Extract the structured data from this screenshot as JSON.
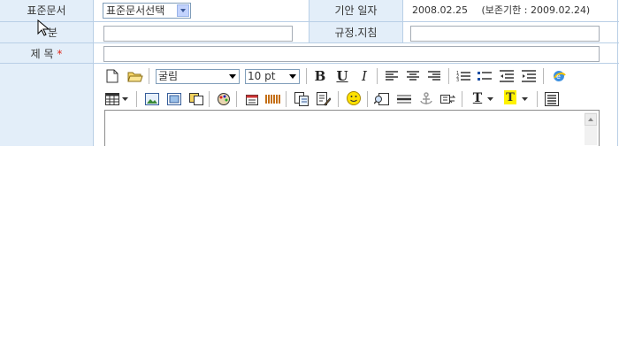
{
  "rows": {
    "standard_doc": {
      "label": "표준문서",
      "select_value": "표준문서선택"
    },
    "draft_date": {
      "label": "기안 일자",
      "value": "2008.02.25",
      "retention": "(보존기한 : 2009.02.24)"
    },
    "category": {
      "label": "분"
    },
    "regulation": {
      "label": "규정.지침"
    },
    "title": {
      "label": "제 목",
      "required_mark": "*"
    }
  },
  "toolbar": {
    "font_name": "굴림",
    "font_size": "10 pt",
    "bold": "B",
    "underline": "U",
    "italic": "I",
    "text_color_glyph": "T",
    "highlight_glyph": "T",
    "emoticon": "☺"
  },
  "colors": {
    "label_bg": "#e3eef9",
    "border": "#b9cfe6",
    "required": "#e0271b"
  }
}
